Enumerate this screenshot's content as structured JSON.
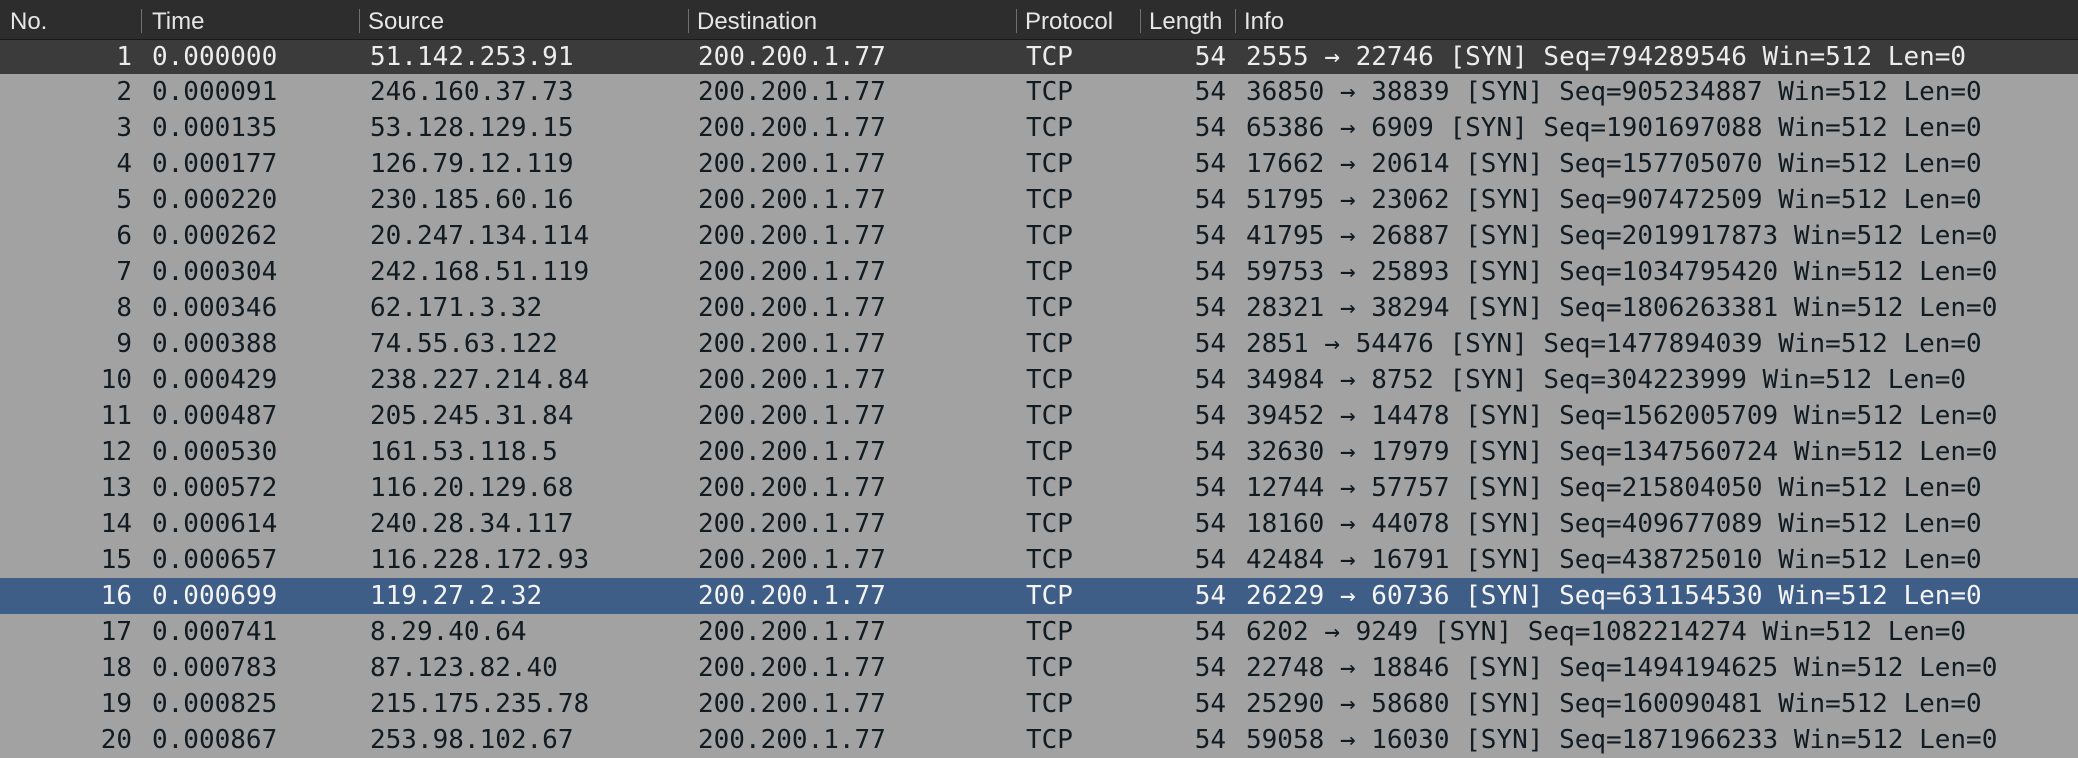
{
  "columns": {
    "no": "No.",
    "time": "Time",
    "source": "Source",
    "destination": "Destination",
    "protocol": "Protocol",
    "length": "Length",
    "info": "Info"
  },
  "colors": {
    "header_bg": "#2d2d2d",
    "row_bg": "#a2a2a2",
    "first_row_bg": "#3b3b3b",
    "selected_row_bg": "#3e5e87"
  },
  "selected_row": 16,
  "packets": [
    {
      "no": "1",
      "time": "0.000000",
      "source": "51.142.253.91",
      "destination": "200.200.1.77",
      "protocol": "TCP",
      "length": "54",
      "info": "2555 → 22746 [SYN] Seq=794289546 Win=512 Len=0"
    },
    {
      "no": "2",
      "time": "0.000091",
      "source": "246.160.37.73",
      "destination": "200.200.1.77",
      "protocol": "TCP",
      "length": "54",
      "info": "36850 → 38839 [SYN] Seq=905234887 Win=512 Len=0"
    },
    {
      "no": "3",
      "time": "0.000135",
      "source": "53.128.129.15",
      "destination": "200.200.1.77",
      "protocol": "TCP",
      "length": "54",
      "info": "65386 → 6909 [SYN] Seq=1901697088 Win=512 Len=0"
    },
    {
      "no": "4",
      "time": "0.000177",
      "source": "126.79.12.119",
      "destination": "200.200.1.77",
      "protocol": "TCP",
      "length": "54",
      "info": "17662 → 20614 [SYN] Seq=157705070 Win=512 Len=0"
    },
    {
      "no": "5",
      "time": "0.000220",
      "source": "230.185.60.16",
      "destination": "200.200.1.77",
      "protocol": "TCP",
      "length": "54",
      "info": "51795 → 23062 [SYN] Seq=907472509 Win=512 Len=0"
    },
    {
      "no": "6",
      "time": "0.000262",
      "source": "20.247.134.114",
      "destination": "200.200.1.77",
      "protocol": "TCP",
      "length": "54",
      "info": "41795 → 26887 [SYN] Seq=2019917873 Win=512 Len=0"
    },
    {
      "no": "7",
      "time": "0.000304",
      "source": "242.168.51.119",
      "destination": "200.200.1.77",
      "protocol": "TCP",
      "length": "54",
      "info": "59753 → 25893 [SYN] Seq=1034795420 Win=512 Len=0"
    },
    {
      "no": "8",
      "time": "0.000346",
      "source": "62.171.3.32",
      "destination": "200.200.1.77",
      "protocol": "TCP",
      "length": "54",
      "info": "28321 → 38294 [SYN] Seq=1806263381 Win=512 Len=0"
    },
    {
      "no": "9",
      "time": "0.000388",
      "source": "74.55.63.122",
      "destination": "200.200.1.77",
      "protocol": "TCP",
      "length": "54",
      "info": "2851 → 54476 [SYN] Seq=1477894039 Win=512 Len=0"
    },
    {
      "no": "10",
      "time": "0.000429",
      "source": "238.227.214.84",
      "destination": "200.200.1.77",
      "protocol": "TCP",
      "length": "54",
      "info": "34984 → 8752 [SYN] Seq=304223999 Win=512 Len=0"
    },
    {
      "no": "11",
      "time": "0.000487",
      "source": "205.245.31.84",
      "destination": "200.200.1.77",
      "protocol": "TCP",
      "length": "54",
      "info": "39452 → 14478 [SYN] Seq=1562005709 Win=512 Len=0"
    },
    {
      "no": "12",
      "time": "0.000530",
      "source": "161.53.118.5",
      "destination": "200.200.1.77",
      "protocol": "TCP",
      "length": "54",
      "info": "32630 → 17979 [SYN] Seq=1347560724 Win=512 Len=0"
    },
    {
      "no": "13",
      "time": "0.000572",
      "source": "116.20.129.68",
      "destination": "200.200.1.77",
      "protocol": "TCP",
      "length": "54",
      "info": "12744 → 57757 [SYN] Seq=215804050 Win=512 Len=0"
    },
    {
      "no": "14",
      "time": "0.000614",
      "source": "240.28.34.117",
      "destination": "200.200.1.77",
      "protocol": "TCP",
      "length": "54",
      "info": "18160 → 44078 [SYN] Seq=409677089 Win=512 Len=0"
    },
    {
      "no": "15",
      "time": "0.000657",
      "source": "116.228.172.93",
      "destination": "200.200.1.77",
      "protocol": "TCP",
      "length": "54",
      "info": "42484 → 16791 [SYN] Seq=438725010 Win=512 Len=0"
    },
    {
      "no": "16",
      "time": "0.000699",
      "source": "119.27.2.32",
      "destination": "200.200.1.77",
      "protocol": "TCP",
      "length": "54",
      "info": "26229 → 60736 [SYN] Seq=631154530 Win=512 Len=0"
    },
    {
      "no": "17",
      "time": "0.000741",
      "source": "8.29.40.64",
      "destination": "200.200.1.77",
      "protocol": "TCP",
      "length": "54",
      "info": "6202 → 9249 [SYN] Seq=1082214274 Win=512 Len=0"
    },
    {
      "no": "18",
      "time": "0.000783",
      "source": "87.123.82.40",
      "destination": "200.200.1.77",
      "protocol": "TCP",
      "length": "54",
      "info": "22748 → 18846 [SYN] Seq=1494194625 Win=512 Len=0"
    },
    {
      "no": "19",
      "time": "0.000825",
      "source": "215.175.235.78",
      "destination": "200.200.1.77",
      "protocol": "TCP",
      "length": "54",
      "info": "25290 → 58680 [SYN] Seq=160090481 Win=512 Len=0"
    },
    {
      "no": "20",
      "time": "0.000867",
      "source": "253.98.102.67",
      "destination": "200.200.1.77",
      "protocol": "TCP",
      "length": "54",
      "info": "59058 → 16030 [SYN] Seq=1871966233 Win=512 Len=0"
    }
  ]
}
